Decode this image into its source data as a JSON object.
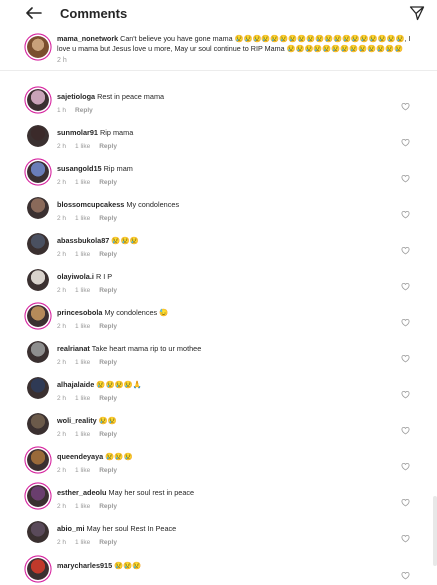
{
  "header": {
    "title": "Comments"
  },
  "caption": {
    "username": "mama_nonetwork",
    "text": " Can't believe you have gone mama 😢😢😢😢😢😢😢😢😢😢😢😢😢😢😢😢😢😢😢, I love u mama but Jesus love u more, May ur soul continue to RIP  Mama 😢😢😢😢😢😢😢😢😢😢😢😢😢",
    "time": "2 h"
  },
  "comments": [
    {
      "username": "sajetiologa",
      "text": "Rest in peace mama",
      "time": "1 h",
      "likes": "",
      "reply": "Reply",
      "avatar_color": "#c9a3b8"
    },
    {
      "username": "sunmolar91",
      "text": "Rip mama",
      "time": "2 h",
      "likes": "1 like",
      "reply": "Reply",
      "avatar_color": "#3b2a2a"
    },
    {
      "username": "susangold15",
      "text": "Rip mam",
      "time": "2 h",
      "likes": "1 like",
      "reply": "Reply",
      "avatar_color": "#6a7db8"
    },
    {
      "username": "blossomcupcakess",
      "text": "My condolences",
      "time": "2 h",
      "likes": "1 like",
      "reply": "Reply",
      "avatar_color": "#8a6a5a"
    },
    {
      "username": "abassbukola87",
      "text": "😢😢😢",
      "time": "2 h",
      "likes": "1 like",
      "reply": "Reply",
      "avatar_color": "#4a5060"
    },
    {
      "username": "olayiwola.i",
      "text": "R I P",
      "time": "2 h",
      "likes": "1 like",
      "reply": "Reply",
      "avatar_color": "#d8d2cc"
    },
    {
      "username": "princesobola",
      "text": "My condolences 😓",
      "time": "2 h",
      "likes": "1 like",
      "reply": "Reply",
      "avatar_color": "#b58a5a"
    },
    {
      "username": "realrianat",
      "text": "Take heart mama rip to ur mothee",
      "time": "2 h",
      "likes": "1 like",
      "reply": "Reply",
      "avatar_color": "#8e8e8e"
    },
    {
      "username": "alhajalaide",
      "text": "😢😢😢😢🙏",
      "time": "2 h",
      "likes": "1 like",
      "reply": "Reply",
      "avatar_color": "#2f3a55"
    },
    {
      "username": "woli_reality",
      "text": "😢😢",
      "time": "2 h",
      "likes": "1 like",
      "reply": "Reply",
      "avatar_color": "#6b5a4a"
    },
    {
      "username": "queendeyaya",
      "text": "😢😢😢",
      "time": "2 h",
      "likes": "1 like",
      "reply": "Reply",
      "avatar_color": "#9a6a3a"
    },
    {
      "username": "esther_adeolu",
      "text": "May her soul rest in peace",
      "time": "2 h",
      "likes": "1 like",
      "reply": "Reply",
      "avatar_color": "#6a3e6e"
    },
    {
      "username": "abio_mi",
      "text": "May her soul Rest In Peace",
      "time": "2 h",
      "likes": "1 like",
      "reply": "Reply",
      "avatar_color": "#5a4a5a"
    },
    {
      "username": "marycharles915",
      "text": "😢😢😢",
      "time": "",
      "likes": "",
      "reply": "",
      "avatar_color": "#c0392b"
    }
  ],
  "colors": {
    "story_ring": "#d6249f",
    "meta_grey": "#9a9a9a",
    "text": "#262626"
  }
}
